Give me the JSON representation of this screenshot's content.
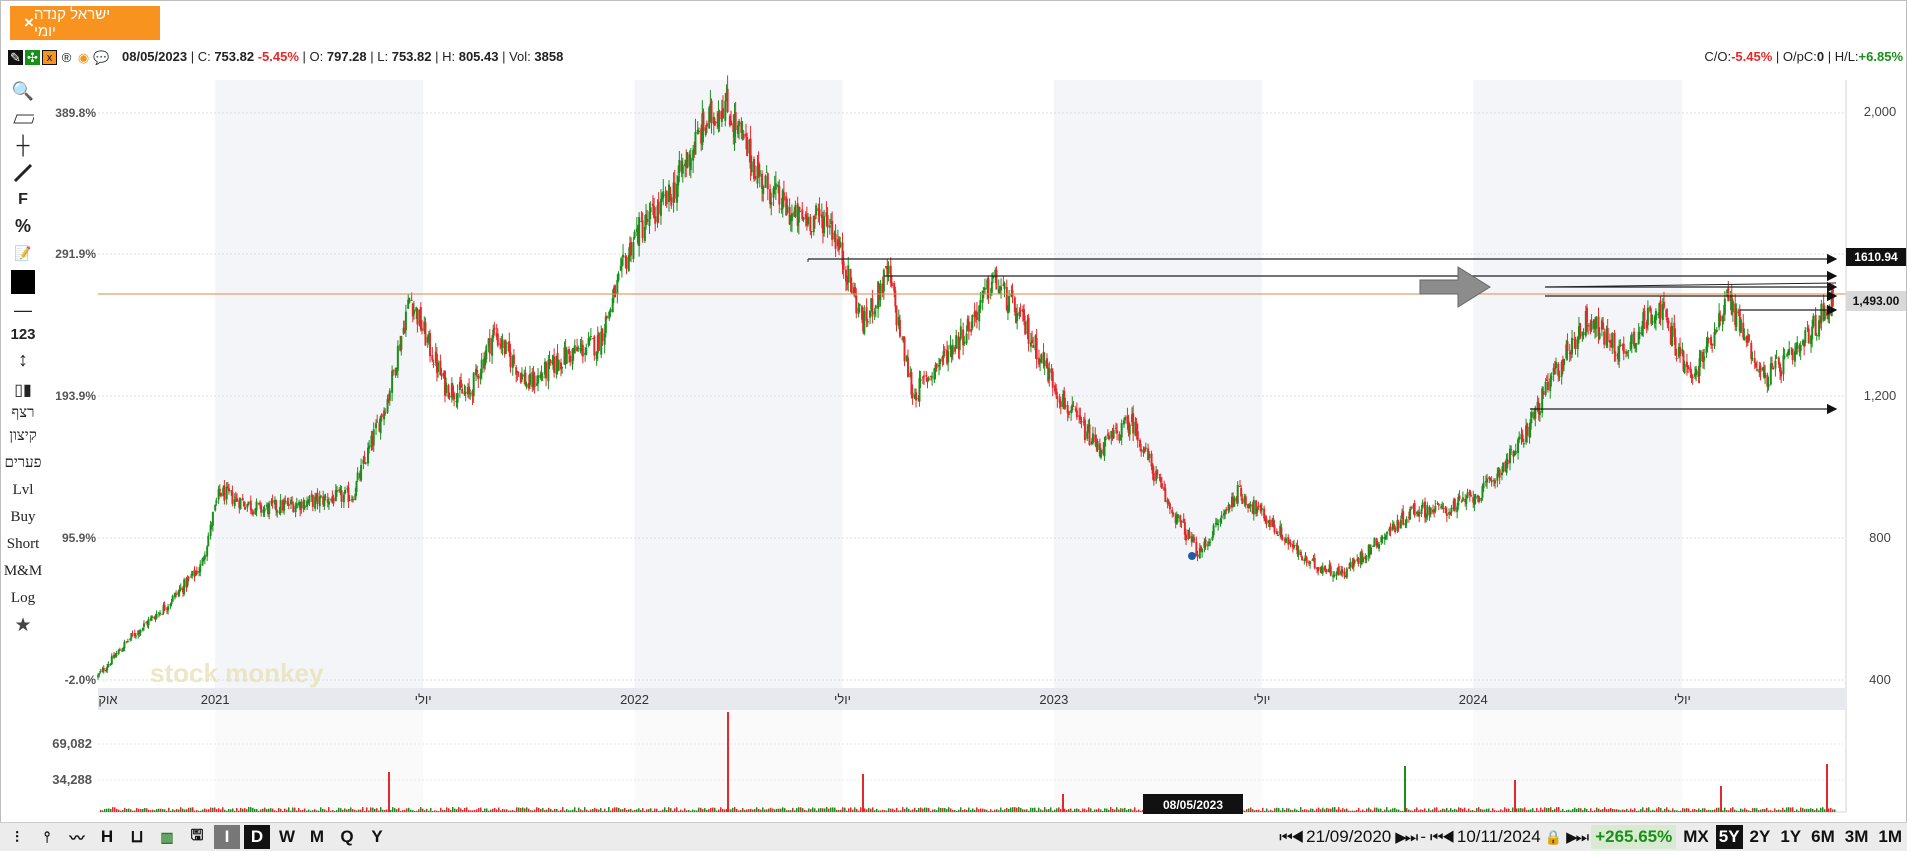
{
  "tab": {
    "title": "ישראל קנדה יומי",
    "close": "×"
  },
  "infobar": {
    "date": "08/05/2023",
    "close_label": "C:",
    "close_value": "753.82",
    "change_pct": "-5.45%",
    "open_label": "O:",
    "open_value": "797.28",
    "low_label": "L:",
    "low_value": "753.82",
    "high_label": "H:",
    "high_value": "805.43",
    "vol_label": "Vol:",
    "vol_value": "3858",
    "co_label": "C/O:",
    "co_value": "-5.45%",
    "opc_label": "O/pC:",
    "opc_value": "0",
    "hl_label": "H/L:",
    "hl_value": "+6.85%"
  },
  "left_tools": [
    "F",
    "%",
    "123",
    "רצף",
    "קיצון",
    "פערים",
    "Lvl",
    "Buy",
    "Short",
    "M&M",
    "Log"
  ],
  "watermark": "stock monkey",
  "cursor_date": "08/05/2023",
  "price_markers": {
    "resistance": "1610.94",
    "current": "1,493.00"
  },
  "colors": {
    "accent": "#f7931e",
    "up": "#1a8f1a",
    "down": "#e5292b",
    "level_line": "#d98a4a"
  },
  "bottombar": {
    "left_buttons": [
      "I",
      "D",
      "W",
      "M",
      "Q",
      "Y"
    ],
    "selected_left": "D",
    "start_date": "21/09/2020",
    "end_date": "10/11/2024",
    "dash": "-",
    "gain": "+265.65%",
    "ranges": [
      "MX",
      "5Y",
      "2Y",
      "1Y",
      "6M",
      "3M",
      "1M"
    ],
    "selected_range": "5Y"
  },
  "chart_data": {
    "type": "candlestick",
    "x_tick_labels": [
      "אוק",
      "2021",
      "יולי",
      "2022",
      "יולי",
      "2023",
      "יולי",
      "2024",
      "יולי"
    ],
    "y_left_ticks": [
      "-2.0%",
      "95.9%",
      "193.9%",
      "291.9%",
      "389.8%"
    ],
    "y_right_ticks": [
      "400",
      "800",
      "1,200",
      "2,000"
    ],
    "y_range": [
      400,
      2100
    ],
    "price_path": [
      {
        "x": "2020-09-21",
        "y": 410
      },
      {
        "x": "2020-10-20",
        "y": 520
      },
      {
        "x": "2020-11-20",
        "y": 610
      },
      {
        "x": "2020-12-20",
        "y": 720
      },
      {
        "x": "2021-01-05",
        "y": 930
      },
      {
        "x": "2021-02-10",
        "y": 880
      },
      {
        "x": "2021-03-20",
        "y": 900
      },
      {
        "x": "2021-05-01",
        "y": 920
      },
      {
        "x": "2021-06-01",
        "y": 1200
      },
      {
        "x": "2021-06-20",
        "y": 1480
      },
      {
        "x": "2021-07-20",
        "y": 1230
      },
      {
        "x": "2021-08-10",
        "y": 1200
      },
      {
        "x": "2021-09-01",
        "y": 1380
      },
      {
        "x": "2021-10-01",
        "y": 1230
      },
      {
        "x": "2021-11-01",
        "y": 1310
      },
      {
        "x": "2021-12-01",
        "y": 1350
      },
      {
        "x": "2022-01-01",
        "y": 1650
      },
      {
        "x": "2022-02-01",
        "y": 1760
      },
      {
        "x": "2022-03-01",
        "y": 1950
      },
      {
        "x": "2022-03-20",
        "y": 2030
      },
      {
        "x": "2022-04-20",
        "y": 1820
      },
      {
        "x": "2022-05-20",
        "y": 1700
      },
      {
        "x": "2022-06-20",
        "y": 1700
      },
      {
        "x": "2022-07-20",
        "y": 1400
      },
      {
        "x": "2022-08-10",
        "y": 1550
      },
      {
        "x": "2022-09-01",
        "y": 1200
      },
      {
        "x": "2022-09-20",
        "y": 1280
      },
      {
        "x": "2022-10-20",
        "y": 1400
      },
      {
        "x": "2022-11-10",
        "y": 1530
      },
      {
        "x": "2022-12-10",
        "y": 1380
      },
      {
        "x": "2023-01-10",
        "y": 1180
      },
      {
        "x": "2023-02-10",
        "y": 1050
      },
      {
        "x": "2023-03-10",
        "y": 1130
      },
      {
        "x": "2023-04-10",
        "y": 900
      },
      {
        "x": "2023-05-08",
        "y": 754
      },
      {
        "x": "2023-06-10",
        "y": 930
      },
      {
        "x": "2023-07-10",
        "y": 840
      },
      {
        "x": "2023-08-10",
        "y": 730
      },
      {
        "x": "2023-09-10",
        "y": 700
      },
      {
        "x": "2023-10-10",
        "y": 790
      },
      {
        "x": "2023-11-10",
        "y": 880
      },
      {
        "x": "2023-12-10",
        "y": 880
      },
      {
        "x": "2024-01-10",
        "y": 930
      },
      {
        "x": "2024-02-10",
        "y": 1060
      },
      {
        "x": "2024-03-10",
        "y": 1250
      },
      {
        "x": "2024-04-10",
        "y": 1420
      },
      {
        "x": "2024-05-10",
        "y": 1320
      },
      {
        "x": "2024-06-10",
        "y": 1460
      },
      {
        "x": "2024-07-10",
        "y": 1240
      },
      {
        "x": "2024-08-10",
        "y": 1480
      },
      {
        "x": "2024-09-10",
        "y": 1250
      },
      {
        "x": "2024-10-10",
        "y": 1320
      },
      {
        "x": "2024-11-10",
        "y": 1480
      }
    ],
    "volume_axis_ticks": [
      "34,288",
      "69,082"
    ],
    "horizontal_levels": [
      1610.94,
      1493.0
    ],
    "grid": true,
    "legend": "none"
  }
}
